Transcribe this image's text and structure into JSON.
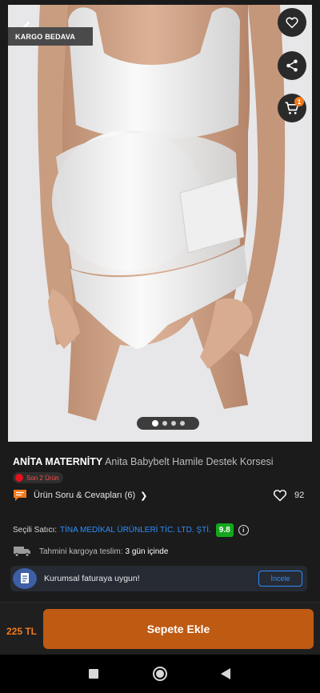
{
  "badge": {
    "kargo": "KARGO BEDAVA"
  },
  "icons": {
    "back": "back-arrow-icon",
    "favorite": "heart-icon",
    "share": "share-icon",
    "cart": "cart-icon",
    "qa": "chat-bubble-icon",
    "likes": "heart-outline-icon",
    "shipping": "truck-icon",
    "invoice": "invoice-icon",
    "info": "info-icon"
  },
  "cart": {
    "count": "1"
  },
  "gallery": {
    "active_index": 1,
    "total": 4
  },
  "product": {
    "brand": "ANİTA MATERNİTY",
    "name": "Anita Babybelt Hamile Destek Korsesi",
    "stock": "Son 2 Ürün",
    "qa_label": "Ürün Soru & Cevapları (6)",
    "likes": "92"
  },
  "seller": {
    "label": "Seçili Satıcı:",
    "name": "TİNA MEDİKAL ÜRÜNLERİ TİC. LTD. ŞTİ.",
    "score": "9.8",
    "info": "i"
  },
  "shipping": {
    "label": "Tahmini kargoya teslim:",
    "days": "3 gün içinde"
  },
  "corporate": {
    "text": "Kurumsal faturaya uygun!",
    "button": "İncele"
  },
  "purchase": {
    "price": "225 TL",
    "button": "Sepete Ekle"
  },
  "colors": {
    "accent": "#f27a1a",
    "button": "#bf5a12",
    "link": "#2f8eff",
    "score": "#14a71d",
    "stock": "#e3121b"
  }
}
